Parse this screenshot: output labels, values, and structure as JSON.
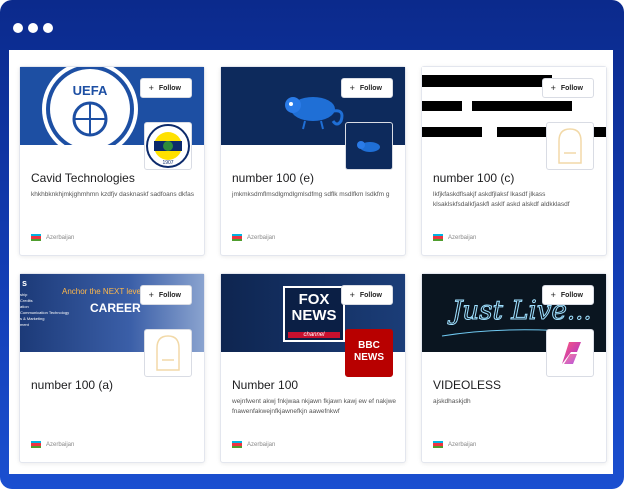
{
  "cards": [
    {
      "title": "Cavid Technologies",
      "description": "khkhbknkhjmkjghmhmn kzdfjv dasknaskf sadfoans dkfas",
      "country": "Azerbaijan",
      "follow_label": "Follow",
      "banner_text": "UEFA",
      "logo_text": "1907",
      "banner_color": "#1d4fa3"
    },
    {
      "title": "number 100 (e)",
      "description": "jmkmksdmflmsdlgmdlgmlsdfmg sdflk msdlfkm lsdkfm g",
      "country": "Azerbaijan",
      "follow_label": "Follow",
      "banner_text": "",
      "logo_text": "",
      "banner_color": "#0d2a5c"
    },
    {
      "title": "number 100 (c)",
      "description": "lkfjkfaskdflsakjf askdfjlaksf lkasdf jlkass klsaklskfsdalkfjaskfl asklf askd alskdf aldkklasdf",
      "country": "Azerbaijan",
      "follow_label": "Follow",
      "banner_text": "",
      "logo_text": "",
      "banner_color": "#ffffff"
    },
    {
      "title": "number 100 (a)",
      "description": "",
      "country": "Azerbaijan",
      "follow_label": "Follow",
      "banner_text": "Anchor the NEXT level",
      "banner_text2": "CAREER",
      "banner_list": [
        "ship",
        "Credits",
        "ation",
        "Communication Technology",
        "s & Marketing",
        "ment"
      ],
      "logo_text": "",
      "banner_color": "#2a4a8e"
    },
    {
      "title": "Number 100",
      "description": "wejnfwent akwj fnkjwaa nkjawn fkjawn kawj ew ef nakjwe fnawenfakwejnfkjawnefkjn aawefnkwf",
      "country": "Azerbaijan",
      "follow_label": "Follow",
      "banner_text": "FOX NEWS",
      "banner_text2": "channel",
      "logo_text": "BBC NEWS",
      "banner_color": "#14305f"
    },
    {
      "title": "VIDEOLESS",
      "description": "ajskdhaskjdh",
      "country": "Azerbaijan",
      "follow_label": "Follow",
      "banner_text": "Just Live...",
      "logo_text": "",
      "banner_color": "#0a1520"
    }
  ]
}
